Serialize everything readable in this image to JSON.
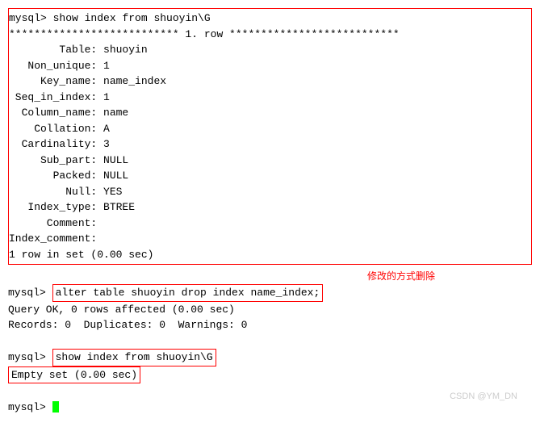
{
  "prompt": "mysql>",
  "cmd1": "show index from shuoyin\\G",
  "row_header": "*************************** 1. row ***************************",
  "index_fields": [
    {
      "label": "        Table",
      "value": "shuoyin"
    },
    {
      "label": "   Non_unique",
      "value": "1"
    },
    {
      "label": "     Key_name",
      "value": "name_index"
    },
    {
      "label": " Seq_in_index",
      "value": "1"
    },
    {
      "label": "  Column_name",
      "value": "name"
    },
    {
      "label": "    Collation",
      "value": "A"
    },
    {
      "label": "  Cardinality",
      "value": "3"
    },
    {
      "label": "     Sub_part",
      "value": "NULL"
    },
    {
      "label": "       Packed",
      "value": "NULL"
    },
    {
      "label": "         Null",
      "value": "YES"
    },
    {
      "label": "   Index_type",
      "value": "BTREE"
    },
    {
      "label": "      Comment",
      "value": ""
    },
    {
      "label": "Index_comment",
      "value": ""
    }
  ],
  "result1": "1 row in set (0.00 sec)",
  "annotation": "修改的方式删除",
  "cmd2": "alter table shuoyin drop index name_index;",
  "result2_line1": "Query OK, 0 rows affected (0.00 sec)",
  "result2_line2": "Records: 0  Duplicates: 0  Warnings: 0",
  "cmd3": "show index from shuoyin\\G",
  "result3": "Empty set (0.00 sec)",
  "watermark": "CSDN @YM_DN"
}
